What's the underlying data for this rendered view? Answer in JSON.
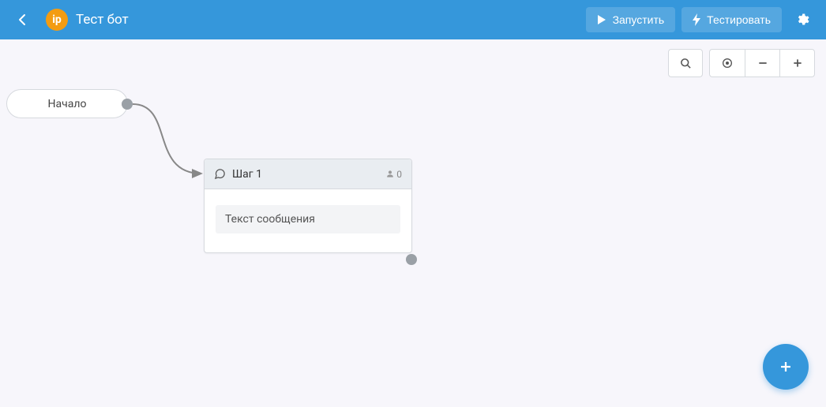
{
  "header": {
    "logo_text": "ip",
    "title": "Тест бот",
    "launch_label": "Запустить",
    "test_label": "Тестировать"
  },
  "canvas": {
    "start_node_label": "Начало",
    "step": {
      "title": "Шаг 1",
      "user_count": "0",
      "message_text": "Текст сообщения"
    }
  }
}
